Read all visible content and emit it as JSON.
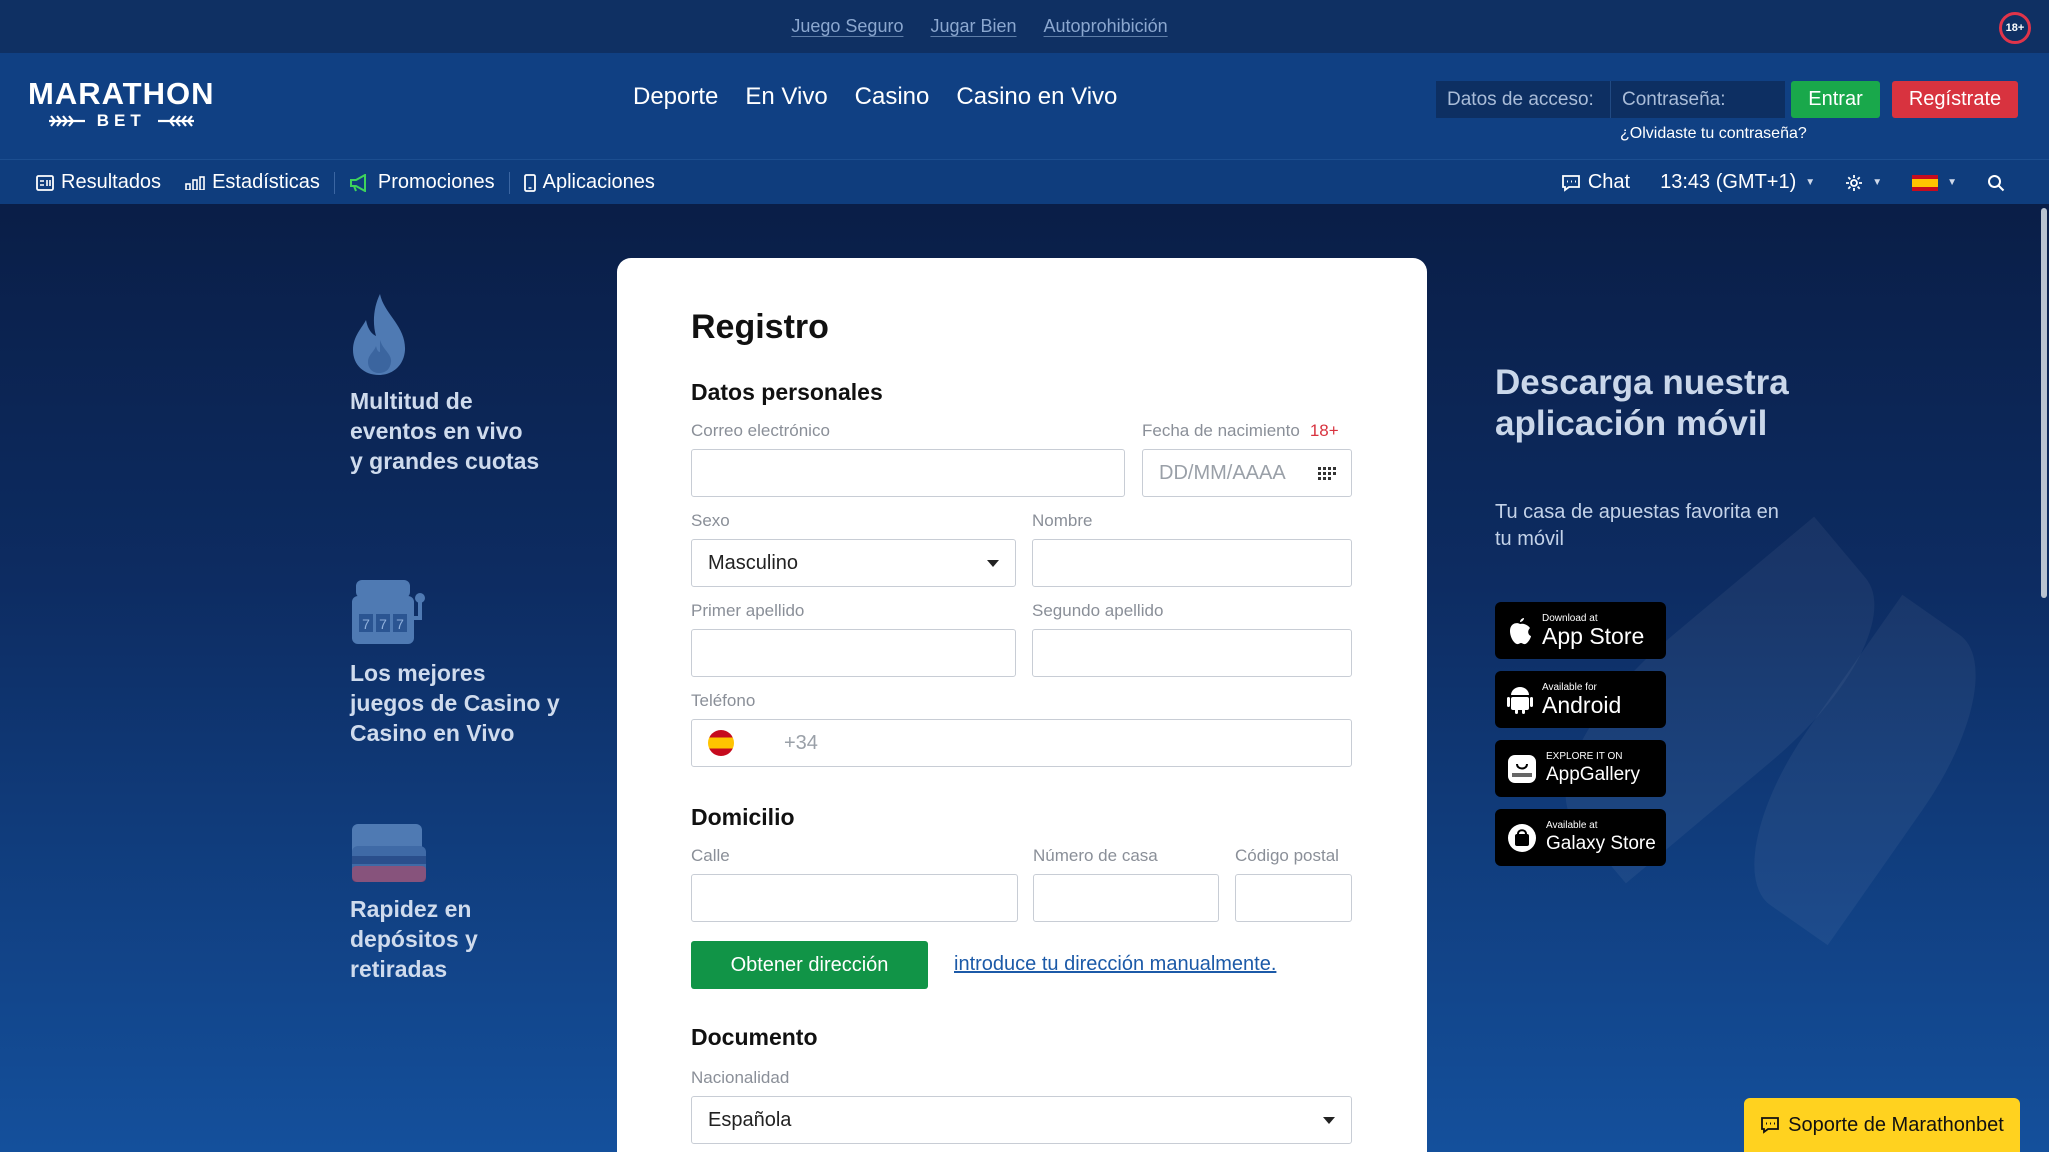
{
  "safety_links": [
    "Juego Seguro",
    "Jugar Bien",
    "Autoprohibición"
  ],
  "age_badge": "18+",
  "logo": {
    "top": "MARATHON",
    "bottom": "BET"
  },
  "main_nav": [
    "Deporte",
    "En Vivo",
    "Casino",
    "Casino en Vivo"
  ],
  "login": {
    "username_placeholder": "Datos de acceso:",
    "password_placeholder": "Contraseña:",
    "enter_label": "Entrar",
    "register_label": "Regístrate",
    "forgot_label": "¿Olvidaste tu contraseña?"
  },
  "subnav": {
    "left": [
      "Resultados",
      "Estadísticas",
      "Promociones",
      "Aplicaciones"
    ],
    "chat": "Chat",
    "time": "13:43 (GMT+1)"
  },
  "features": [
    {
      "icon": "flame-icon",
      "text": "Multitud de eventos en vivo y grandes cuotas"
    },
    {
      "icon": "slot-machine-icon",
      "text": "Los mejores juegos de Casino y Casino en Vivo"
    },
    {
      "icon": "credit-cards-icon",
      "text": "Rapidez en depósitos y retiradas"
    }
  ],
  "form": {
    "title": "Registro",
    "personal_title": "Datos personales",
    "email_label": "Correo electrónico",
    "birthdate_label": "Fecha de nacimiento",
    "birthdate_age": "18+",
    "birthdate_placeholder": "DD/MM/AAAA",
    "sex_label": "Sexo",
    "sex_value": "Masculino",
    "name_label": "Nombre",
    "surname1_label": "Primer apellido",
    "surname2_label": "Segundo apellido",
    "phone_label": "Teléfono",
    "phone_prefix": "+34",
    "address_title": "Domicilio",
    "street_label": "Calle",
    "house_label": "Número de casa",
    "postal_label": "Código postal",
    "get_address_label": "Obtener dirección",
    "manual_link": "introduce tu dirección manualmente.",
    "document_title": "Documento",
    "nationality_label": "Nacionalidad",
    "nationality_value": "Española"
  },
  "app_promo": {
    "title": "Descarga nuestra aplicación móvil",
    "subtitle": "Tu casa de apuestas favorita en tu móvil",
    "stores": [
      {
        "icon": "apple-icon",
        "small": "Download at",
        "big": "App Store"
      },
      {
        "icon": "android-icon",
        "small": "Available for",
        "big": "Android"
      },
      {
        "icon": "huawei-icon",
        "small": "EXPLORE IT ON",
        "big": "AppGallery"
      },
      {
        "icon": "galaxy-store-icon",
        "small": "Available at",
        "big": "Galaxy Store"
      }
    ]
  },
  "support_label": "Soporte de Marathonbet",
  "colors": {
    "header_blue": "#104083",
    "green": "#19a84b",
    "red": "#d8333f",
    "support_yellow": "#ffd21f"
  }
}
